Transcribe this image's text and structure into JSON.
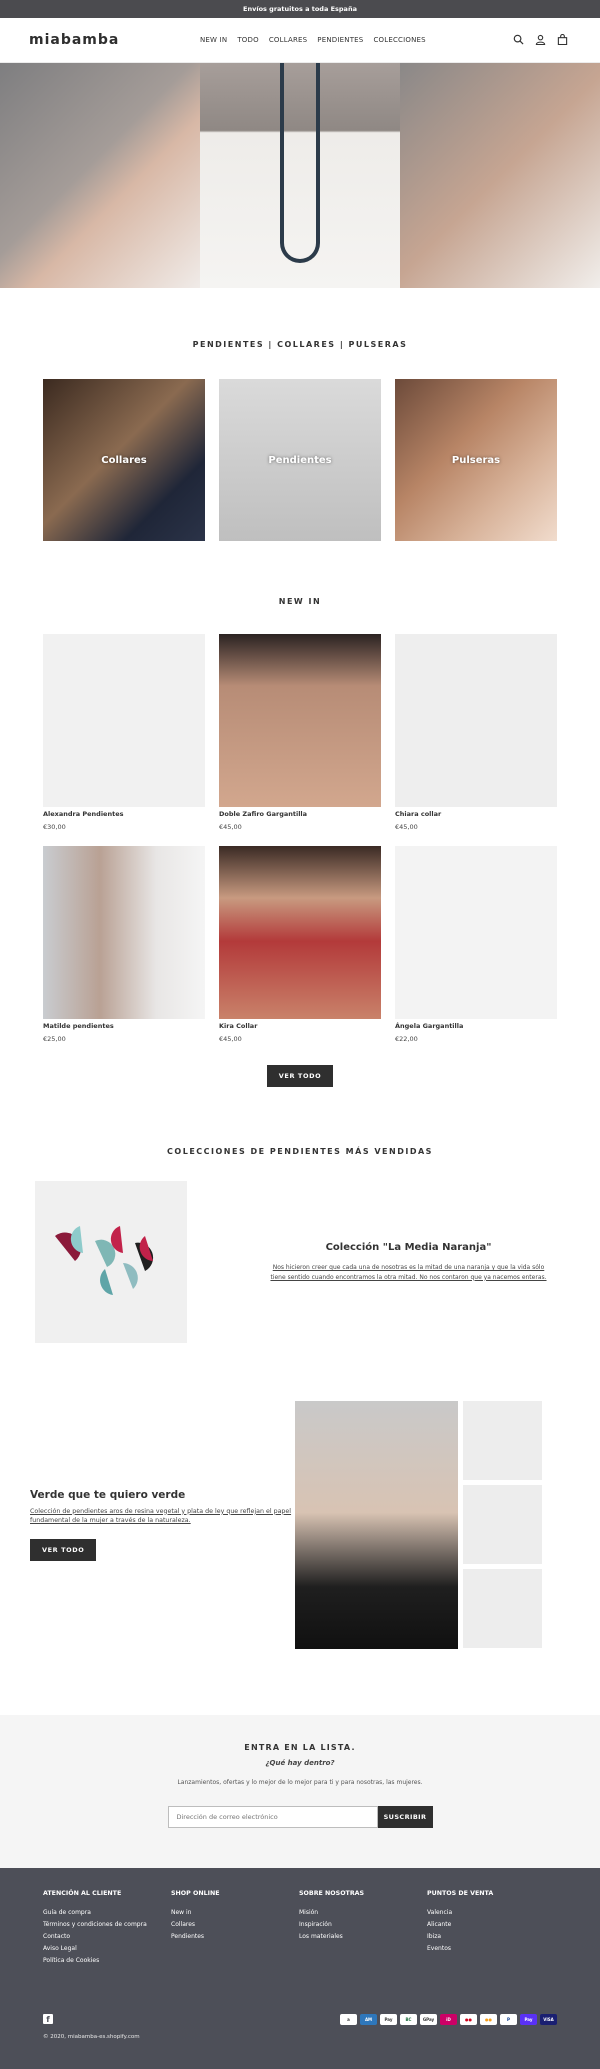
{
  "announcement": "Envíos gratuitos a toda España",
  "brand": "miabamba",
  "nav": [
    "NEW IN",
    "TODO",
    "COLLARES",
    "PENDIENTES",
    "COLECCIONES"
  ],
  "header_icons": [
    "search-icon",
    "account-icon",
    "cart-icon"
  ],
  "categories_section": {
    "title": "PENDIENTES | COLLARES | PULSERAS",
    "items": [
      "Collares",
      "Pendientes",
      "Pulseras"
    ]
  },
  "new_in": {
    "title": "NEW IN",
    "products": [
      {
        "name": "Alexandra Pendientes",
        "price": "€30,00"
      },
      {
        "name": "Doble Zafiro Gargantilla",
        "price": "€45,00"
      },
      {
        "name": "Chiara collar",
        "price": "€45,00"
      },
      {
        "name": "Matilde pendientes",
        "price": "€25,00"
      },
      {
        "name": "Kira Collar",
        "price": "€45,00"
      },
      {
        "name": "Ángela Gargantilla",
        "price": "€22,00"
      }
    ],
    "button": "VER TODO"
  },
  "featured": {
    "title": "COLECCIONES DE PENDIENTES MÁS VENDIDAS",
    "collection_title": "Colección \"La Media Naranja\"",
    "collection_desc": "Nos hicieron creer que cada una de nosotras es la mitad de una naranja y que la vida sólo tiene sentido cuando encontramos la otra mitad. No nos contaron que ya nacemos enteras."
  },
  "green": {
    "title": "Verde que te quiero verde",
    "desc": "Colección de pendientes aros de resina vegetal y plata de ley que reflejan el papel fundamental de la mujer a través de la naturaleza.",
    "button": "VER TODO"
  },
  "newsletter": {
    "title": "ENTRA EN LA LISTA.",
    "subtitle": "¿Qué hay dentro?",
    "text": "Lanzamientos, ofertas y lo mejor de lo mejor para ti y para nosotras, las mujeres.",
    "placeholder": "Dirección de correo electrónico",
    "button": "SUSCRIBIR"
  },
  "footer": {
    "columns": [
      {
        "title": "ATENCIÓN AL CLIENTE",
        "links": [
          "Guía de compra",
          "Términos y condiciones de compra",
          "Contacto",
          "Aviso Legal",
          "Política de Cookies"
        ]
      },
      {
        "title": "SHOP ONLINE",
        "links": [
          "New in",
          "Collares",
          "Pendientes"
        ]
      },
      {
        "title": "SOBRE NOSOTRAS",
        "links": [
          "Misión",
          "Inspiración",
          "Los materiales"
        ]
      },
      {
        "title": "PUNTOS DE VENTA",
        "links": [
          "Valencia",
          "Alicante",
          "Ibiza",
          "Eventos"
        ]
      }
    ],
    "copyright": "© 2020, miabamba-es.shopify.com",
    "payments": [
      "AMAZON",
      "AMEX",
      "APPLE",
      "BANCONTACT",
      "GPAY",
      "IDEAL",
      "MAESTRO",
      "MASTER",
      "PAYPAL",
      "SHOPPAY",
      "VISA"
    ]
  }
}
